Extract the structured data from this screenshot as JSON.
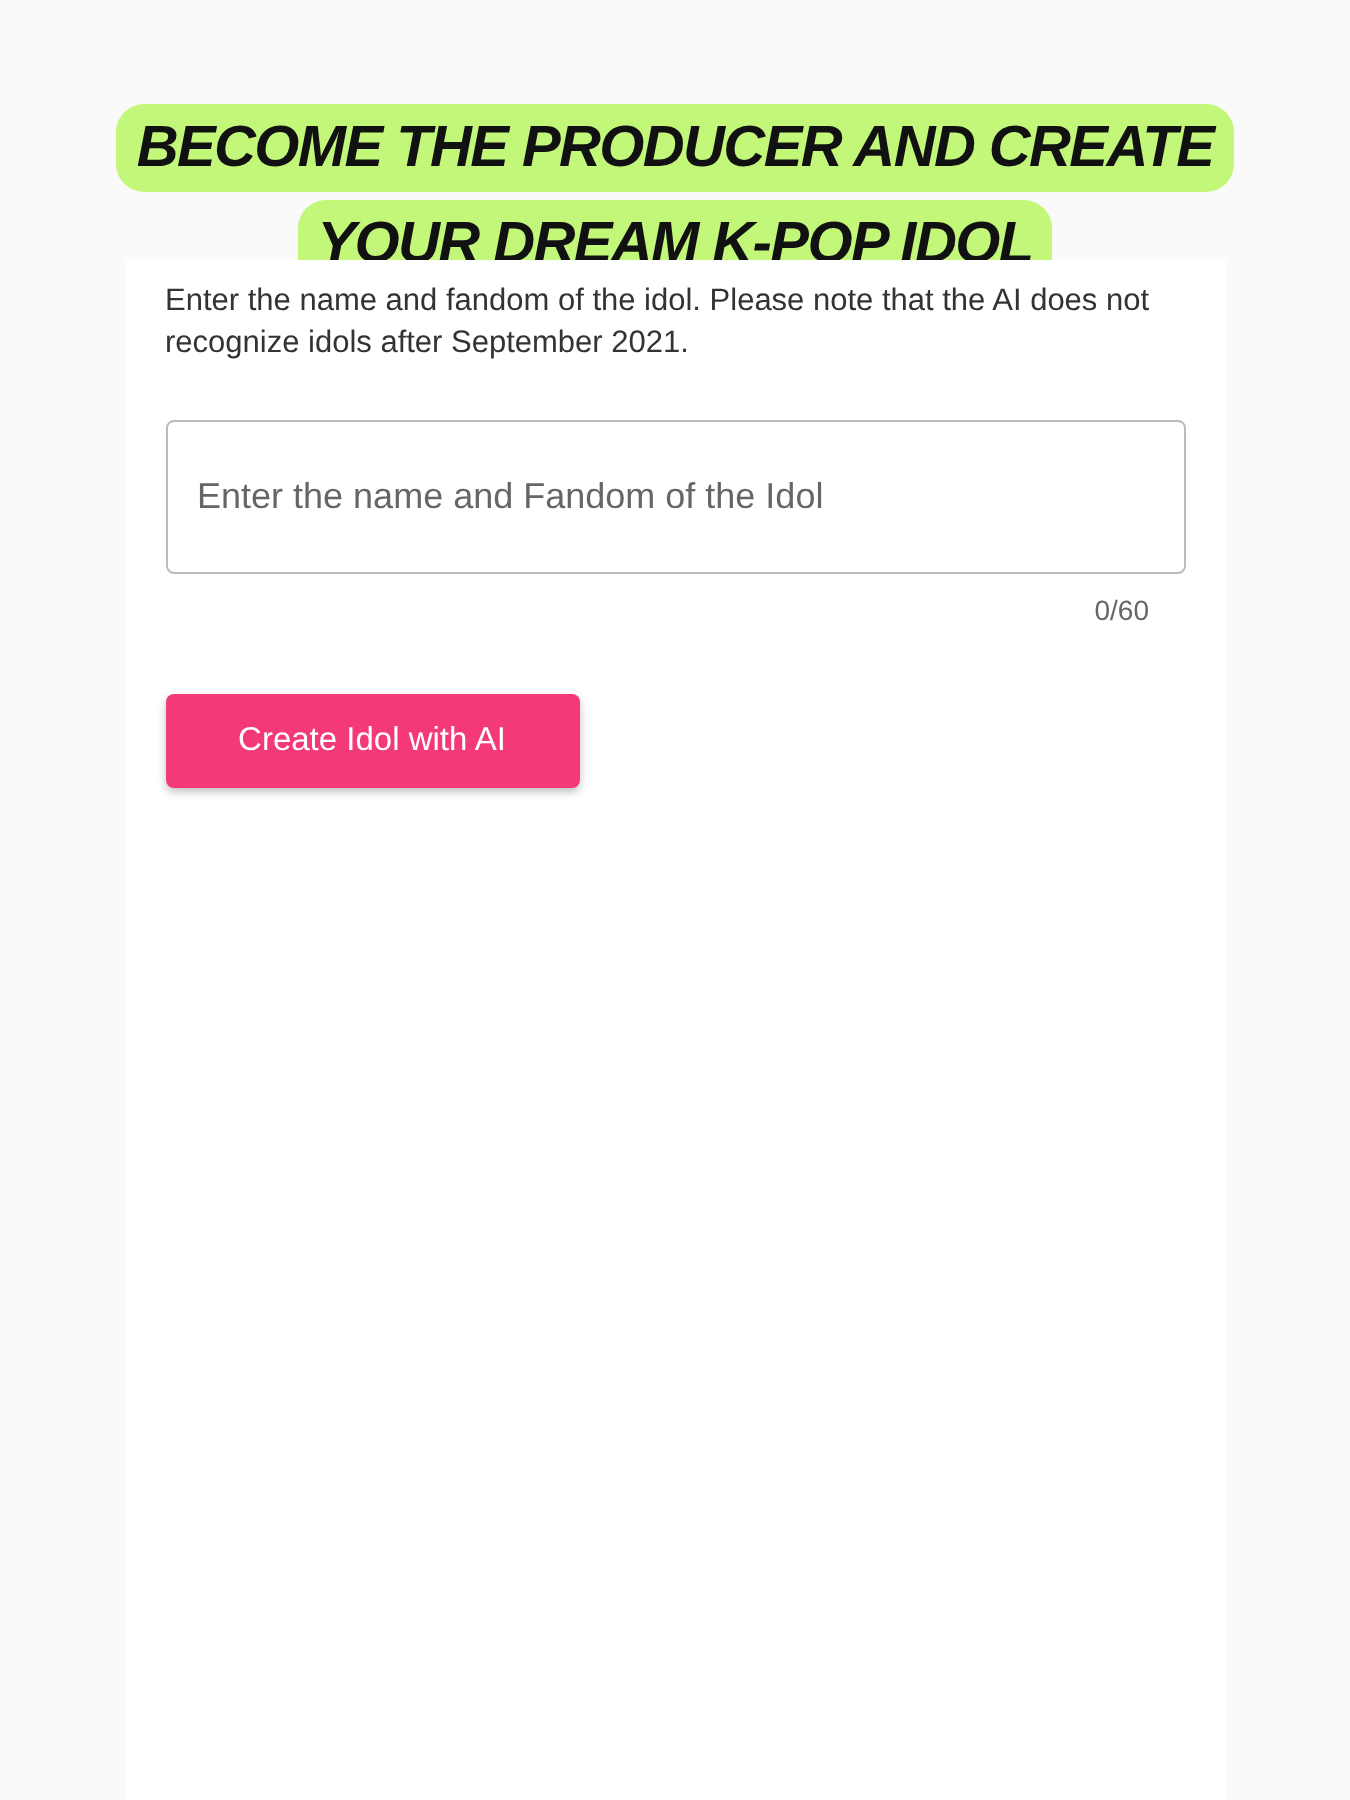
{
  "banner": {
    "title": "BECOME THE PRODUCER AND CREATE YOUR DREAM K-POP IDOL"
  },
  "form": {
    "instructions": "Enter the name and fandom of the idol. Please note that the AI does not recognize idols after September 2021.",
    "input": {
      "placeholder": "Enter the name and Fandom of the Idol"
    },
    "counter": "0/60",
    "button": "Create Idol with AI"
  }
}
